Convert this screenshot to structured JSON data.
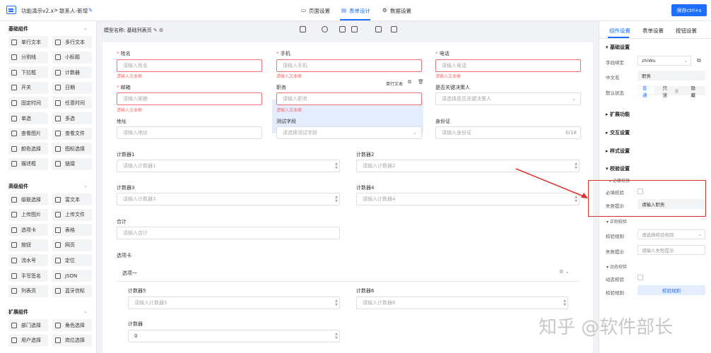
{
  "header": {
    "app_title": "功能演示v2.x",
    "sep": ">",
    "breadcrumb": "联系人-新增",
    "tabs": [
      "页面设置",
      "表单设计",
      "数据设置"
    ],
    "save_label": "保存ctrl+s"
  },
  "sidebar": {
    "groups": [
      {
        "title": "基础组件",
        "items": [
          "单行文本",
          "多行文本",
          "分割线",
          "小标题",
          "下拉框",
          "计数器",
          "开关",
          "日期",
          "固定时间",
          "任意时间",
          "单选",
          "多选",
          "查看图片",
          "查看文件",
          "颜色选择",
          "图标选择",
          "描述框",
          "链接"
        ]
      },
      {
        "title": "高级组件",
        "items": [
          "级联选择",
          "富文本",
          "上传图片",
          "上传文件",
          "选项卡",
          "表格",
          "按钮",
          "网页",
          "流水号",
          "定位",
          "手写签名",
          "JSON",
          "列表页",
          "蓝牙信标"
        ]
      },
      {
        "title": "扩展组件",
        "items": [
          "部门选择",
          "角色选择",
          "用户选择",
          "岗位选择"
        ]
      }
    ]
  },
  "toolbar": {
    "model_label": "模型名称:",
    "model_name": "基础列表页"
  },
  "form": {
    "name": {
      "label": "姓名",
      "placeholder": "请输入姓名",
      "error": "请输入文本框"
    },
    "phone": {
      "label": "手机",
      "placeholder": "请输入手机",
      "error": "请输入文本框"
    },
    "tel": {
      "label": "电话",
      "placeholder": "请输入电话",
      "error": "请输入文本框"
    },
    "email": {
      "label": "邮箱",
      "placeholder": "请输入邮箱",
      "error": "请输入文本框"
    },
    "job": {
      "label": "职务",
      "placeholder": "请输入职务",
      "error": "请输入文本框",
      "tag": "单行文本"
    },
    "key": {
      "label": "是否关键决策人",
      "placeholder": "请选择是否关键决策人"
    },
    "addr": {
      "label": "地址",
      "placeholder": "请输入地址"
    },
    "test": {
      "label": "测试字段",
      "placeholder": "请选择测试字段"
    },
    "idcard": {
      "label": "身份证",
      "placeholder": "请输入身份证",
      "count": "0/18"
    },
    "c1": {
      "label": "计数器1",
      "placeholder": "请输入计数器1"
    },
    "c2": {
      "label": "计数器2",
      "placeholder": "请输入计数器2"
    },
    "c3": {
      "label": "计数器3",
      "placeholder": "请输入计数器3"
    },
    "c4": {
      "label": "计数器4",
      "placeholder": "请输入计数器4"
    },
    "total": {
      "label": "合计",
      "placeholder": "请输入合计"
    },
    "tabs_label": "选项卡",
    "tab_one": "选项一",
    "c5": {
      "label": "计数器5",
      "placeholder": "请输入计数器5"
    },
    "c6": {
      "label": "计数器6",
      "placeholder": "请输入计数器6"
    },
    "c0": {
      "label": "计数器",
      "value": "0"
    }
  },
  "right": {
    "tabs": [
      "组件设置",
      "表单设置",
      "按钮设置"
    ],
    "basic": "基础设置",
    "field_bind_label": "字段绑定",
    "field_bind_value": "zhiWu",
    "cn_label": "中文名",
    "cn_value": "职务",
    "default_label": "默认状态",
    "states": [
      "普通",
      "只读",
      "隐藏"
    ],
    "ext": "扩展功能",
    "interact": "交互设置",
    "style": "样式设置",
    "verify": "校验设置",
    "required_sub": "必填校验",
    "required_label": "必填校验",
    "fail_label": "失败提示",
    "fail_value": "请输入职务",
    "regex_sub": "正则校验",
    "rule_label": "校验规则",
    "rule_placeholder": "请选择校验规则",
    "fail2_label": "失败提示",
    "fail2_placeholder": "请输入失败提示",
    "dyn_sub": "动态校验",
    "dyn_label": "动态校验",
    "dyn_rule_label": "校验规则",
    "dyn_rule_btn": "校验规则"
  },
  "watermark": "知乎 @软件部长",
  "colors": {
    "accent": "#1e6fff",
    "error": "#f56c6c",
    "annotation": "#d9342b"
  }
}
